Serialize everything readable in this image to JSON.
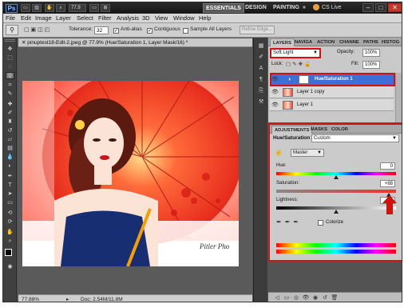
{
  "titlebar": {
    "logo": "Ps",
    "btn1": "▭",
    "btn2": "▥",
    "zoom": "77.9",
    "btn3": "▭",
    "btn4": "⊞",
    "workspaces": [
      "ESSENTIALS",
      "DESIGN",
      "PAINTING",
      "»"
    ],
    "cslive": "CS Live",
    "min": "–",
    "max": "□",
    "close": "✕"
  },
  "menubar": {
    "items": [
      "File",
      "Edit",
      "Image",
      "Layer",
      "Select",
      "Filter",
      "Analysis",
      "3D",
      "View",
      "Window",
      "Help"
    ]
  },
  "options": {
    "tolerance_label": "Tolerance:",
    "tolerance_value": "32",
    "antialias": "Anti-alias",
    "contiguous": "Contiguous",
    "sample": "Sample All Layers",
    "refine": "Refine Edge..."
  },
  "document": {
    "tab_title": "pinuptest18-Edit-2.jpeg @ 77.9% (Hue/Saturation 1, Layer Mask/16) *",
    "signature": "Pitler Pho",
    "status_zoom": "77.88%",
    "status_doc": "Doc: 2.54M/11.8M"
  },
  "layers_panel": {
    "tabs": [
      "LAYERS",
      "NAVIGA",
      "ACTION",
      "CHANNE",
      "PATHS",
      "HISTOG"
    ],
    "blend_mode": "Soft Light",
    "opacity_label": "Opacity:",
    "opacity_value": "100%",
    "lock_label": "Lock:",
    "fill_label": "Fill:",
    "fill_value": "100%",
    "rows": [
      {
        "name": "Hue/Saturation 1"
      },
      {
        "name": "Layer 1 copy"
      },
      {
        "name": "Layer 1"
      }
    ]
  },
  "adjustments": {
    "tabs": [
      "ADJUSTMENTS",
      "MASKS",
      "COLOR"
    ],
    "header": "Hue/Saturation",
    "preset": "Custom",
    "channel": "Master",
    "hue_label": "Hue:",
    "hue_value": "0",
    "hue_level": 0.5,
    "saturation_label": "Saturation:",
    "saturation_value": "+88",
    "saturation_level": 0.94,
    "lightness_label": "Lightness:",
    "lightness_value": "0",
    "lightness_level": 0.5,
    "colorize": "Colorize"
  },
  "colors": {
    "accent_red": "#d41111",
    "panel": "#c9c9c9",
    "selected_layer": "#3d6fd8"
  }
}
